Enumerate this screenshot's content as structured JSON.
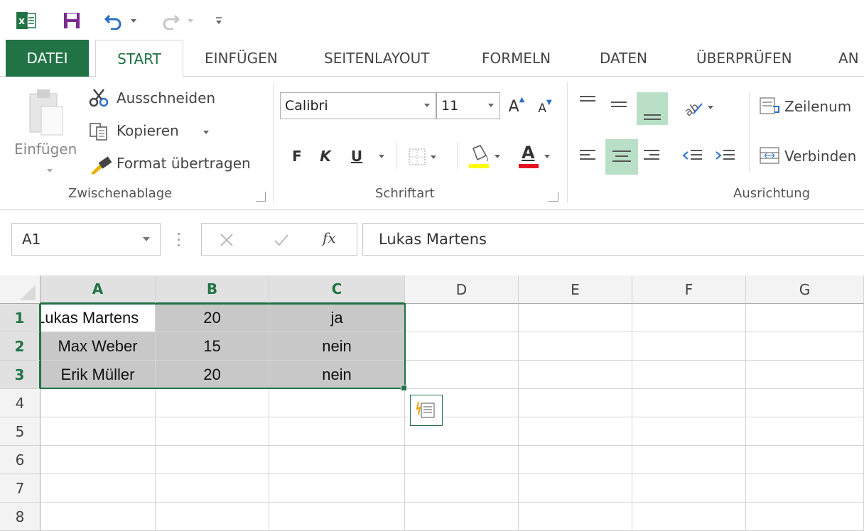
{
  "qat": {
    "excel_icon": "excel-icon",
    "save_icon": "save-icon",
    "undo_icon": "undo-icon",
    "redo_icon": "redo-icon",
    "customize_icon": "customize-qat-icon"
  },
  "tabs": [
    "DATEI",
    "START",
    "EINFÜGEN",
    "SEITENLAYOUT",
    "FORMELN",
    "DATEN",
    "ÜBERPRÜFEN",
    "AN"
  ],
  "active_tab": "START",
  "ribbon": {
    "clipboard": {
      "paste_label": "Einfügen",
      "cut_label": "Ausschneiden",
      "copy_label": "Kopieren",
      "format_painter_label": "Format übertragen",
      "group_label": "Zwischenablage"
    },
    "font": {
      "font_name": "Calibri",
      "font_size": "11",
      "grow_label": "A",
      "shrink_label": "A",
      "bold_label": "F",
      "italic_label": "K",
      "underline_label": "U",
      "font_color_label": "A",
      "fill_color": "#ffff00",
      "font_color": "#e81123",
      "group_label": "Schriftart"
    },
    "alignment": {
      "wrap_label": "Zeilenum",
      "merge_label": "Verbinden",
      "group_label": "Ausrichtung"
    }
  },
  "formula_bar": {
    "name_box": "A1",
    "fx_label": "fx",
    "formula": "Lukas Martens"
  },
  "sheet": {
    "columns": [
      "A",
      "B",
      "C",
      "D",
      "E",
      "F",
      "G"
    ],
    "rows": [
      "1",
      "2",
      "3",
      "4",
      "5",
      "6",
      "7",
      "8"
    ],
    "cells": [
      [
        "Lukas Martens",
        "20",
        "ja"
      ],
      [
        "Max Weber",
        "15",
        "nein"
      ],
      [
        "Erik Müller",
        "20",
        "nein"
      ]
    ],
    "quick_analysis_icon": "quick-analysis-icon"
  },
  "colors": {
    "accent": "#217346",
    "selection_shade": "#c8c8c8",
    "header_bg": "#f3f3f3"
  }
}
